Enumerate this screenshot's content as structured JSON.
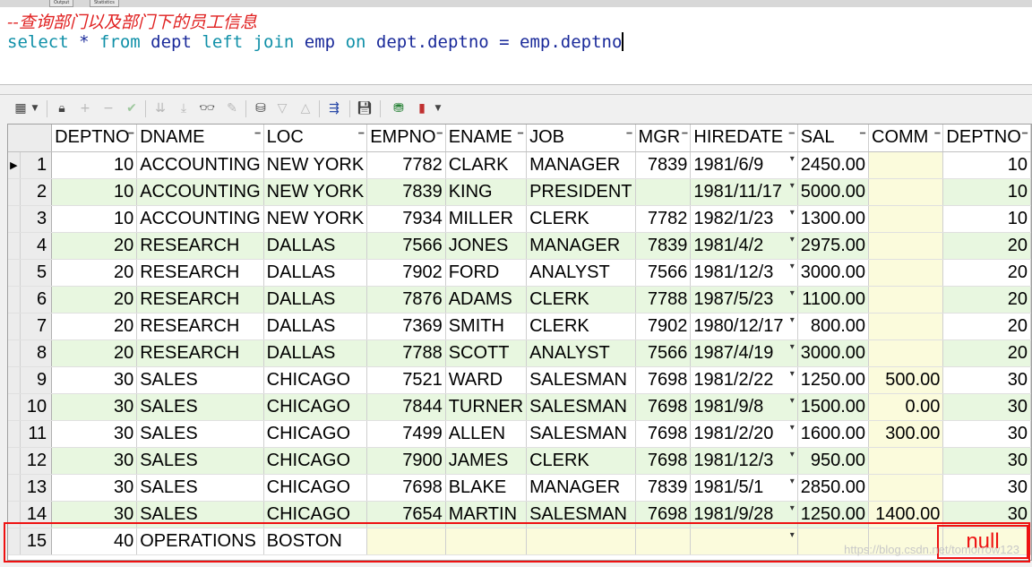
{
  "top_tabs": [
    "Output",
    "Statistics"
  ],
  "editor": {
    "comment": "--查询部门以及部门下的员工信息",
    "sql_tokens": [
      {
        "t": "select",
        "k": true
      },
      {
        "t": " * ",
        "k": false
      },
      {
        "t": "from",
        "k": true
      },
      {
        "t": " dept ",
        "k": false
      },
      {
        "t": "left",
        "k": true
      },
      {
        "t": " ",
        "k": false
      },
      {
        "t": "join",
        "k": true
      },
      {
        "t": " emp ",
        "k": false
      },
      {
        "t": "on",
        "k": true
      },
      {
        "t": " dept.deptno = emp.deptno",
        "k": false
      }
    ]
  },
  "toolbar": {
    "icons": [
      "grid-select-icon",
      "lock-icon",
      "add-row-icon",
      "delete-row-icon",
      "post-changes-icon",
      "next-page-icon",
      "last-page-icon",
      "find-icon",
      "clear-icon",
      "query-by-example-icon",
      "filter-down-icon",
      "filter-up-icon",
      "export-icon",
      "save-icon",
      "connection-icon",
      "chart-icon"
    ]
  },
  "columns": [
    "DEPTNO",
    "DNAME",
    "LOC",
    "EMPNO",
    "ENAME",
    "JOB",
    "MGR",
    "HIREDATE",
    "SAL",
    "COMM",
    "DEPTNO"
  ],
  "rows": [
    [
      "1",
      "10",
      "ACCOUNTING",
      "NEW YORK",
      "7782",
      "CLARK",
      "MANAGER",
      "7839",
      "1981/6/9",
      "2450.00",
      "",
      "10"
    ],
    [
      "2",
      "10",
      "ACCOUNTING",
      "NEW YORK",
      "7839",
      "KING",
      "PRESIDENT",
      "",
      "1981/11/17",
      "5000.00",
      "",
      "10"
    ],
    [
      "3",
      "10",
      "ACCOUNTING",
      "NEW YORK",
      "7934",
      "MILLER",
      "CLERK",
      "7782",
      "1982/1/23",
      "1300.00",
      "",
      "10"
    ],
    [
      "4",
      "20",
      "RESEARCH",
      "DALLAS",
      "7566",
      "JONES",
      "MANAGER",
      "7839",
      "1981/4/2",
      "2975.00",
      "",
      "20"
    ],
    [
      "5",
      "20",
      "RESEARCH",
      "DALLAS",
      "7902",
      "FORD",
      "ANALYST",
      "7566",
      "1981/12/3",
      "3000.00",
      "",
      "20"
    ],
    [
      "6",
      "20",
      "RESEARCH",
      "DALLAS",
      "7876",
      "ADAMS",
      "CLERK",
      "7788",
      "1987/5/23",
      "1100.00",
      "",
      "20"
    ],
    [
      "7",
      "20",
      "RESEARCH",
      "DALLAS",
      "7369",
      "SMITH",
      "CLERK",
      "7902",
      "1980/12/17",
      "800.00",
      "",
      "20"
    ],
    [
      "8",
      "20",
      "RESEARCH",
      "DALLAS",
      "7788",
      "SCOTT",
      "ANALYST",
      "7566",
      "1987/4/19",
      "3000.00",
      "",
      "20"
    ],
    [
      "9",
      "30",
      "SALES",
      "CHICAGO",
      "7521",
      "WARD",
      "SALESMAN",
      "7698",
      "1981/2/22",
      "1250.00",
      "500.00",
      "30"
    ],
    [
      "10",
      "30",
      "SALES",
      "CHICAGO",
      "7844",
      "TURNER",
      "SALESMAN",
      "7698",
      "1981/9/8",
      "1500.00",
      "0.00",
      "30"
    ],
    [
      "11",
      "30",
      "SALES",
      "CHICAGO",
      "7499",
      "ALLEN",
      "SALESMAN",
      "7698",
      "1981/2/20",
      "1600.00",
      "300.00",
      "30"
    ],
    [
      "12",
      "30",
      "SALES",
      "CHICAGO",
      "7900",
      "JAMES",
      "CLERK",
      "7698",
      "1981/12/3",
      "950.00",
      "",
      "30"
    ],
    [
      "13",
      "30",
      "SALES",
      "CHICAGO",
      "7698",
      "BLAKE",
      "MANAGER",
      "7839",
      "1981/5/1",
      "2850.00",
      "",
      "30"
    ],
    [
      "14",
      "30",
      "SALES",
      "CHICAGO",
      "7654",
      "MARTIN",
      "SALESMAN",
      "7698",
      "1981/9/28",
      "1250.00",
      "1400.00",
      "30"
    ],
    [
      "15",
      "40",
      "OPERATIONS",
      "BOSTON",
      "",
      "",
      "",
      "",
      "",
      "",
      "",
      ""
    ]
  ],
  "annotation": {
    "null_label": "null"
  },
  "watermark": "https://blog.csdn.net/tomorrow123"
}
